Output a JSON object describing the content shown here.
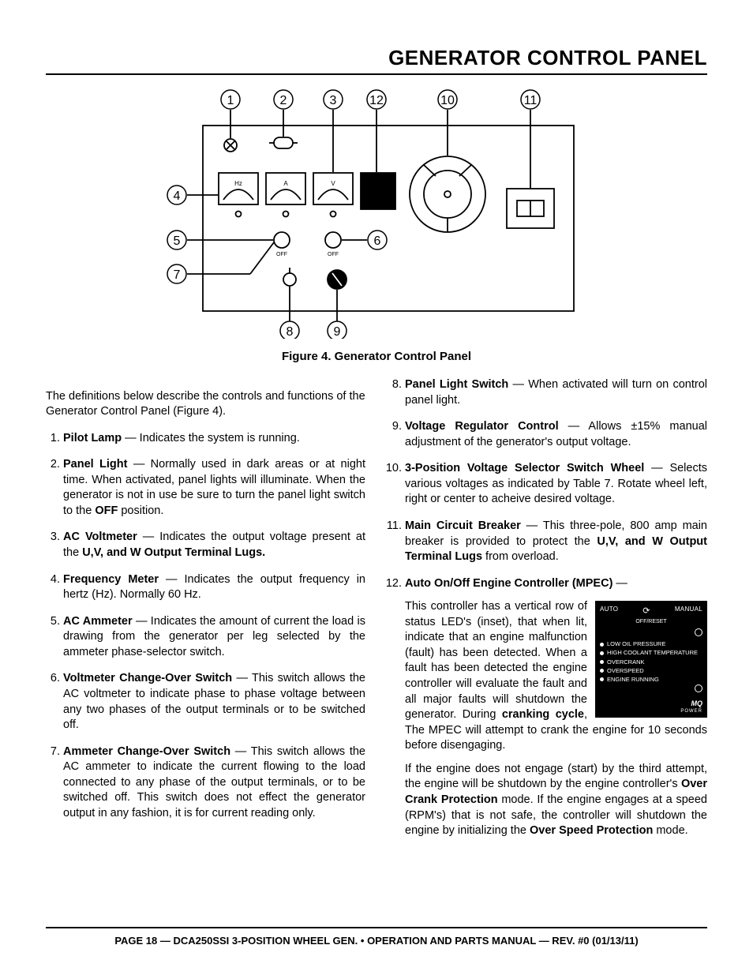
{
  "title": "GENERATOR CONTROL PANEL",
  "caption": "Figure 4. Generator Control Panel",
  "intro": "The definitions below describe the controls and functions of the Generator Control Panel (Figure 4).",
  "callouts": [
    "1",
    "2",
    "3",
    "12",
    "10",
    "11",
    "4",
    "5",
    "6",
    "7",
    "8",
    "9"
  ],
  "left": [
    {
      "n": "1",
      "t": "Pilot Lamp",
      "d": " — Indicates the system is running."
    },
    {
      "n": "2",
      "t": "Panel Light",
      "d": " — Normally used in dark areas or at night time. When activated, panel lights will illuminate. When the generator is not in use be sure to turn the panel light switch to the <b>OFF</b> position."
    },
    {
      "n": "3",
      "t": "AC Voltmeter",
      "d": " — Indicates the output voltage present at the <b>U,V, and W Output Terminal Lugs.</b>"
    },
    {
      "n": "4",
      "t": "Frequency Meter",
      "d": " — Indicates the output frequency in hertz (Hz). Normally 60 Hz."
    },
    {
      "n": "5",
      "t": "AC Ammeter",
      "d": " — Indicates the amount of current the load is drawing from the generator per leg selected by the ammeter phase-selector switch."
    },
    {
      "n": "6",
      "t": "Voltmeter Change-Over Switch",
      "d": " — This switch allows the AC voltmeter to indicate phase to phase voltage between any two phases of the output terminals or to be switched off."
    },
    {
      "n": "7",
      "t": "Ammeter Change-Over Switch",
      "d": " — This switch allows the AC ammeter to indicate the current flowing to the load connected to any phase of the output terminals, or to be switched off. This switch does not effect the generator output in any fashion, it is for current reading only."
    }
  ],
  "right": [
    {
      "n": "8",
      "t": "Panel Light Switch",
      "d": " — When activated will turn on control panel light."
    },
    {
      "n": "9",
      "t": "Voltage Regulator Control",
      "d": " — Allows ±15% manual adjustment of the generator's output voltage."
    },
    {
      "n": "10",
      "t": "3-Position Voltage Selector Switch Wheel",
      "d": " — Selects various voltages as indicated by Table 7. Rotate wheel left, right or center to acheive desired voltage."
    },
    {
      "n": "11",
      "t": "Main Circuit Breaker",
      "d": " — This three-pole, 800 amp main breaker is provided to protect the <b>U,V, and W Output Terminal Lugs</b> from overload."
    },
    {
      "n": "12",
      "t": "Auto On/Off Engine Controller (MPEC)",
      "d": " —",
      "paras": [
        "This controller has a vertical row of status LED's (inset), that when lit, indicate that an engine malfunction (fault) has been detected. When a fault has been detected the engine controller will evaluate the fault and all major faults will shutdown the generator. During <b>cranking cycle</b>, The MPEC will attempt to crank the engine for 10 seconds before disengaging.",
        "If the engine does not engage (start) by the third attempt, the engine will be shutdown by the engine controller's <b>Over Crank Protection</b> mode. If the engine engages at a speed (RPM's) that is not safe, the controller will shutdown the engine by initializing the <b>Over Speed Protection</b> mode."
      ]
    }
  ],
  "inset": {
    "auto": "AUTO",
    "manual": "MANUAL",
    "off": "OFF/RESET",
    "leds": [
      "LOW OIL PRESSURE",
      "HIGH COOLANT TEMPERATURE",
      "OVERCRANK",
      "OVERSPEED",
      "ENGINE RUNNING"
    ],
    "brand": "MQ",
    "sub": "POWER"
  },
  "footer": "PAGE 18 — DCA250SSI 3-POSITION WHEEL GEN. • OPERATION AND PARTS MANUAL — REV. #0 (01/13/11)"
}
